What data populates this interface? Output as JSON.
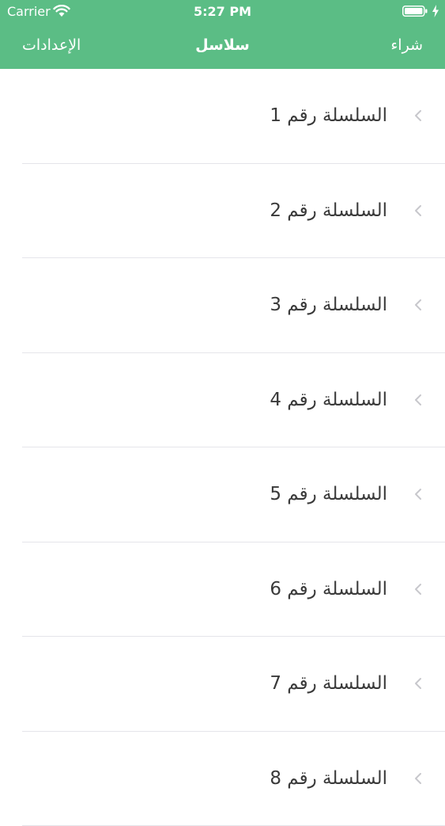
{
  "status_bar": {
    "carrier": "Carrier",
    "time": "5:27 PM"
  },
  "nav": {
    "left_label": "الإعدادات",
    "title": "سلاسل",
    "right_label": "شراء"
  },
  "colors": {
    "header_background": "#5bbd85",
    "text": "#3a3a3a",
    "separator": "#e5e5ea",
    "chevron": "#c7c7cc"
  },
  "series_list": [
    {
      "label": "السلسلة رقم 1"
    },
    {
      "label": "السلسلة رقم 2"
    },
    {
      "label": "السلسلة رقم 3"
    },
    {
      "label": "السلسلة رقم 4"
    },
    {
      "label": "السلسلة رقم 5"
    },
    {
      "label": "السلسلة رقم 6"
    },
    {
      "label": "السلسلة رقم 7"
    },
    {
      "label": "السلسلة رقم 8"
    }
  ]
}
